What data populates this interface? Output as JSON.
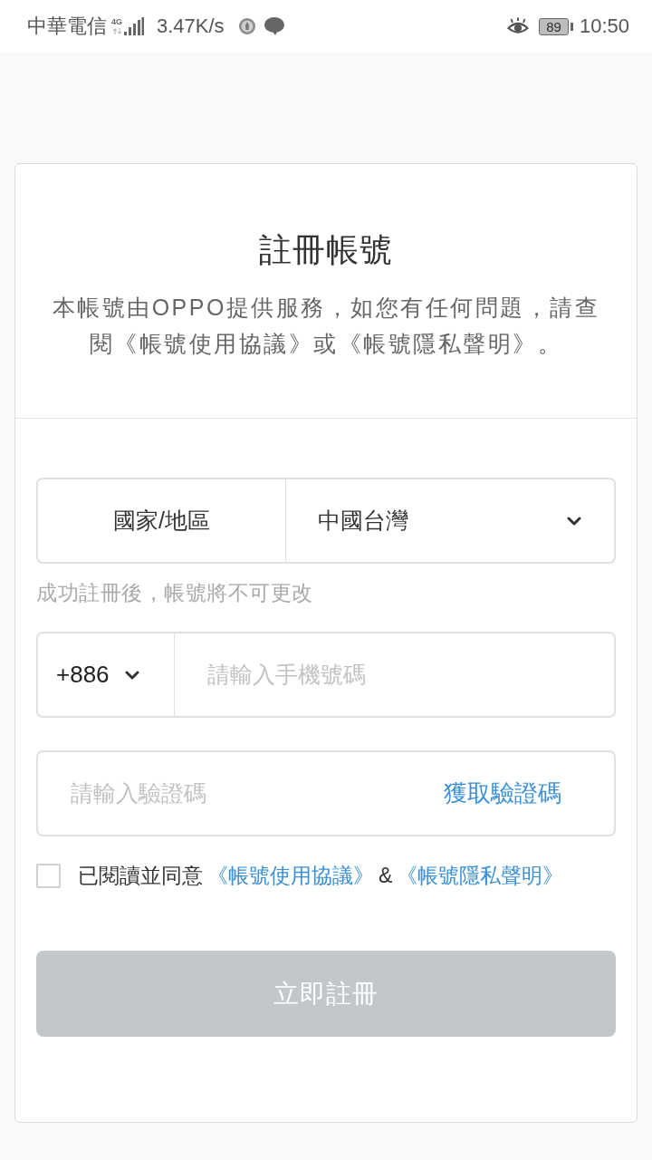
{
  "status_bar": {
    "carrier": "中華電信",
    "network_type": "4G",
    "speed": "3.47K/s",
    "battery": "89",
    "time": "10:50"
  },
  "header": {
    "title": "註冊帳號",
    "description": "本帳號由OPPO提供服務，如您有任何問題，請查閱《帳號使用協議》或《帳號隱私聲明》。"
  },
  "region": {
    "label": "國家/地區",
    "value": "中國台灣"
  },
  "region_hint": "成功註冊後，帳號將不可更改",
  "phone": {
    "country_code": "+886",
    "placeholder": "請輸入手機號碼"
  },
  "verification": {
    "placeholder": "請輸入驗證碼",
    "action": "獲取驗證碼"
  },
  "agreement": {
    "checked": false,
    "parts": [
      {
        "kind": "text",
        "text": "已閱讀並同意"
      },
      {
        "kind": "link",
        "text": "《帳號使用協議》"
      },
      {
        "kind": "text",
        "text": "&"
      },
      {
        "kind": "link",
        "text": "《帳號隱私聲明》"
      }
    ]
  },
  "submit": {
    "label": "立即註冊",
    "disabled": true
  }
}
